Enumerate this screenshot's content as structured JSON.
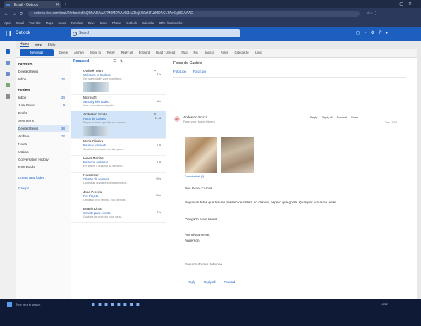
{
  "browser": {
    "tab_title": "Email - Outlook",
    "url": "outlook.live.com/mail/0/inbox/id/AQMkADAwATM0MDAAMS1hZDdjLWIzNTUtMDACLTAwCgBGAAAD",
    "bookmarks": [
      "Apps",
      "Gmail",
      "YouTube",
      "Maps",
      "News",
      "Translate",
      "Drive",
      "Docs",
      "Photos",
      "Outlook",
      "Calendar",
      "Other bookmarks"
    ]
  },
  "header": {
    "app_name": "Outlook",
    "search_placeholder": "Search"
  },
  "ribbon": {
    "tabs": [
      "Home",
      "View",
      "Help"
    ],
    "new_mail_label": "New mail",
    "actions": [
      "Delete",
      "Archive",
      "Move to",
      "Reply",
      "Reply all",
      "Forward",
      "Read / Unread",
      "Flag",
      "Pin",
      "Snooze",
      "Rules",
      "Categorize",
      "Undo"
    ]
  },
  "folders": {
    "favorites_header": "Favorites",
    "favorites": [
      {
        "label": "Deleted Items",
        "count": ""
      },
      {
        "label": "Inbox",
        "count": "12"
      }
    ],
    "folders_header": "Folders",
    "items": [
      {
        "label": "Inbox",
        "count": "24"
      },
      {
        "label": "Junk Email",
        "count": "9"
      },
      {
        "label": "Drafts",
        "count": ""
      },
      {
        "label": "Sent Items",
        "count": ""
      },
      {
        "label": "Deleted Items",
        "count": "38"
      },
      {
        "label": "Archive",
        "count": "12"
      },
      {
        "label": "Notes",
        "count": ""
      },
      {
        "label": "Outbox",
        "count": ""
      },
      {
        "label": "Conversation History",
        "count": ""
      },
      {
        "label": "RSS Feeds",
        "count": ""
      }
    ],
    "new_folder_link": "Create new folder",
    "groups_link": "Groups"
  },
  "message_list": {
    "title": "Focused",
    "messages": [
      {
        "from": "Outlook Team",
        "subject": "Welcome to Outlook",
        "preview": "Get started with your new inbox...",
        "time": "Tue",
        "has_thumb": true,
        "selected": false
      },
      {
        "from": "Microsoft",
        "subject": "Security info added",
        "preview": "Your account security info...",
        "time": "Mon",
        "has_thumb": false,
        "selected": false
      },
      {
        "from": "Anderson Souza",
        "subject": "Fotos do Castelo",
        "preview": "Segue as fotos que tirei no passeio...",
        "time": "11:52",
        "has_thumb": true,
        "selected": true
      },
      {
        "from": "Maria Oliveira",
        "subject": "Reuniao de sexta",
        "preview": "Confirmando nossa reuniao para...",
        "time": "Thu",
        "has_thumb": false,
        "selected": false
      },
      {
        "from": "Lucas Martins",
        "subject": "Relatorio semanal",
        "preview": "Em anexo o relatorio da semana...",
        "time": "Thu",
        "has_thumb": false,
        "selected": false
      },
      {
        "from": "Newsletter",
        "subject": "Ofertas da semana",
        "preview": "Confira as novidades desta semana...",
        "time": "Wed",
        "has_thumb": false,
        "selected": false
      },
      {
        "from": "Joao Pereira",
        "subject": "Re: Projeto",
        "preview": "Obrigado pelo retorno, vou verificar...",
        "time": "Wed",
        "has_thumb": false,
        "selected": false
      },
      {
        "from": "Beatriz Lima",
        "subject": "Convite para evento",
        "preview": "Gostaria de convidar voce para...",
        "time": "Tue",
        "has_thumb": false,
        "selected": false
      }
    ]
  },
  "reading_pane": {
    "subject": "Fotos do Castelo",
    "attachments": [
      "Foto1.jpg",
      "Foto2.jpg"
    ],
    "sender": "Anderson Souza",
    "recipients": "Para: voce; Maria Oliveira",
    "avatar_initials": "AS",
    "actions": [
      "Reply",
      "Reply all",
      "Forward",
      "More"
    ],
    "date": "Thu 11:52",
    "photo_caption": "Download all (2)",
    "body_lines": [
      "Boa tarde, Camila",
      "Segue as fotos que tirei no passeio de ontem no castelo, espero que goste. Qualquer coisa me avise.",
      "Obrigado e ate breve!",
      "Atenciosamente,",
      "Anderson"
    ],
    "signature": "Enviado do meu telefone",
    "reply_actions": [
      "Reply",
      "Reply all",
      "Forward"
    ]
  },
  "taskbar": {
    "search_placeholder": "Type here to search",
    "clock": "11:52"
  },
  "colors": {
    "accent": "#1d5fbf",
    "browser_bg": "#2b3a5c",
    "taskbar": "#0e1a36"
  }
}
